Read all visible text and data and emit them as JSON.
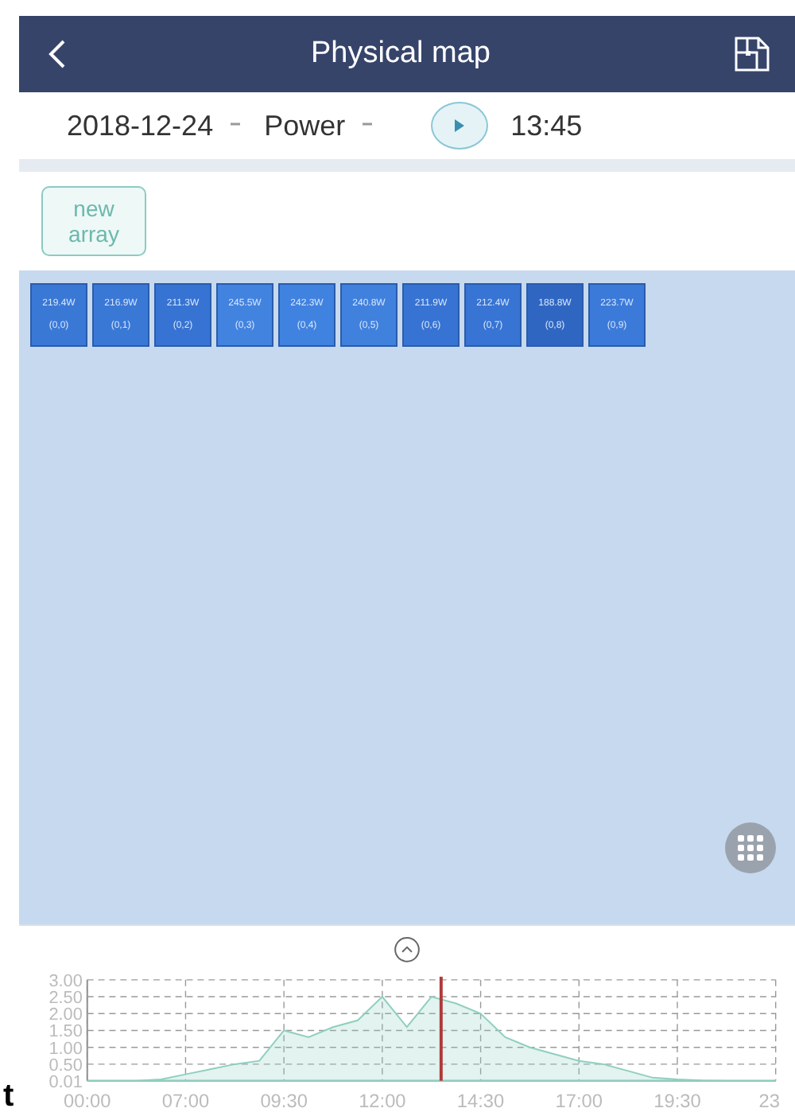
{
  "header": {
    "title": "Physical map"
  },
  "toolbar": {
    "date": "2018-12-24",
    "metric": "Power",
    "time": "13:45",
    "playing": false
  },
  "new_array_button": {
    "label": "new\narray"
  },
  "panels": [
    {
      "power": "219.4W",
      "position": "(0,0)",
      "color": "#3a78d6"
    },
    {
      "power": "216.9W",
      "position": "(0,1)",
      "color": "#3a78d6"
    },
    {
      "power": "211.3W",
      "position": "(0,2)",
      "color": "#3773d2"
    },
    {
      "power": "245.5W",
      "position": "(0,3)",
      "color": "#4283e0"
    },
    {
      "power": "242.3W",
      "position": "(0,4)",
      "color": "#4082df"
    },
    {
      "power": "240.8W",
      "position": "(0,5)",
      "color": "#4081de"
    },
    {
      "power": "211.9W",
      "position": "(0,6)",
      "color": "#3773d2"
    },
    {
      "power": "212.4W",
      "position": "(0,7)",
      "color": "#3774d3"
    },
    {
      "power": "188.8W",
      "position": "(0,8)",
      "color": "#2f66c2"
    },
    {
      "power": "223.7W",
      "position": "(0,9)",
      "color": "#3b7ad8"
    }
  ],
  "chart_data": {
    "type": "area",
    "categories": [
      "00:00",
      null,
      null,
      null,
      "07:00",
      null,
      null,
      null,
      "09:30",
      null,
      null,
      null,
      "12:00",
      null,
      null,
      null,
      "14:30",
      null,
      null,
      null,
      "17:00",
      null,
      null,
      null,
      "19:30",
      null,
      null,
      null,
      "23"
    ],
    "series": [
      {
        "color": "#8fcfc0",
        "values": [
          0.01,
          0.01,
          0.01,
          0.05,
          0.2,
          0.35,
          0.5,
          0.6,
          1.5,
          1.3,
          1.6,
          1.8,
          2.5,
          1.6,
          2.5,
          2.3,
          2.0,
          1.3,
          1.0,
          0.8,
          0.6,
          0.5,
          0.3,
          0.1,
          0.05,
          0.02,
          0.01,
          0.01,
          0.01
        ]
      }
    ],
    "ylim": [
      0.01,
      3
    ],
    "yticks": [
      {
        "value": 0.01,
        "label": "0.01"
      },
      {
        "value": 0.5,
        "label": "0.50"
      },
      {
        "value": 1,
        "label": "1.00"
      },
      {
        "value": 1.5,
        "label": "1.50"
      },
      {
        "value": 2,
        "label": "2.00"
      },
      {
        "value": 2.5,
        "label": "2.50"
      },
      {
        "value": 3,
        "label": "3.00"
      }
    ],
    "grid": true
  },
  "time_marker": {
    "level": 0.514
  },
  "stray_text": "t"
}
